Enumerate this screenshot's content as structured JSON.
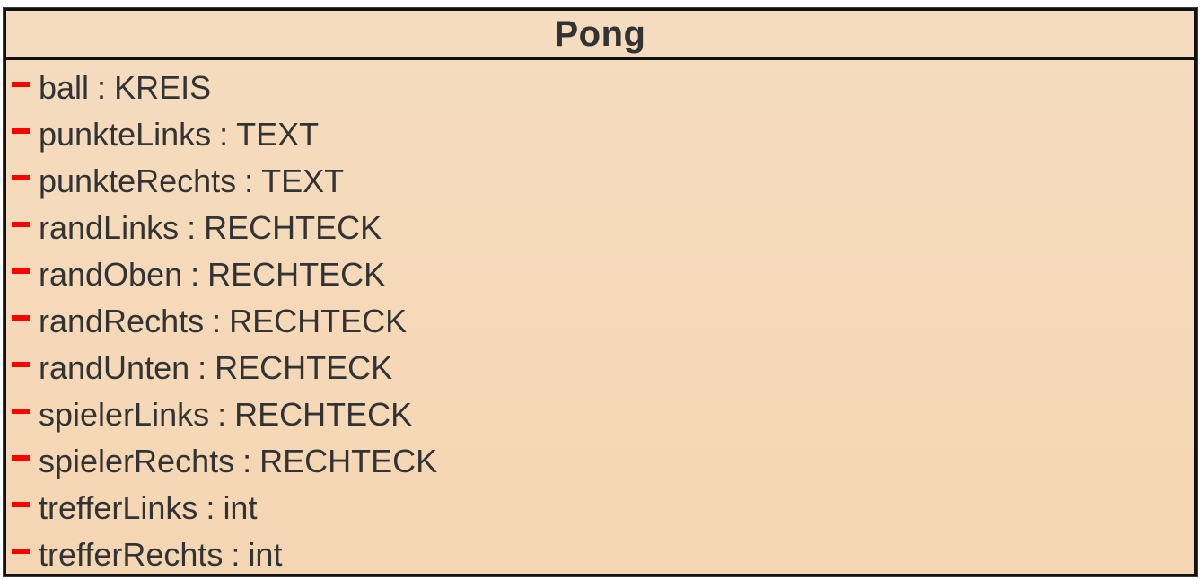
{
  "class": {
    "name": "Pong",
    "attributes": [
      {
        "visibility": "private",
        "name": "ball",
        "type": "KREIS"
      },
      {
        "visibility": "private",
        "name": "punkteLinks",
        "type": "TEXT"
      },
      {
        "visibility": "private",
        "name": "punkteRechts",
        "type": "TEXT"
      },
      {
        "visibility": "private",
        "name": "randLinks",
        "type": "RECHTECK"
      },
      {
        "visibility": "private",
        "name": "randOben",
        "type": "RECHTECK"
      },
      {
        "visibility": "private",
        "name": "randRechts",
        "type": "RECHTECK"
      },
      {
        "visibility": "private",
        "name": "randUnten",
        "type": "RECHTECK"
      },
      {
        "visibility": "private",
        "name": "spielerLinks",
        "type": "RECHTECK"
      },
      {
        "visibility": "private",
        "name": "spielerRechts",
        "type": "RECHTECK"
      },
      {
        "visibility": "private",
        "name": "trefferLinks",
        "type": "int"
      },
      {
        "visibility": "private",
        "name": "trefferRechts",
        "type": "int"
      }
    ],
    "separator": ":"
  },
  "colors": {
    "private_marker": "#ff0000",
    "box_fill": "#f5d9b9",
    "border": "#111111",
    "text": "#333333"
  }
}
